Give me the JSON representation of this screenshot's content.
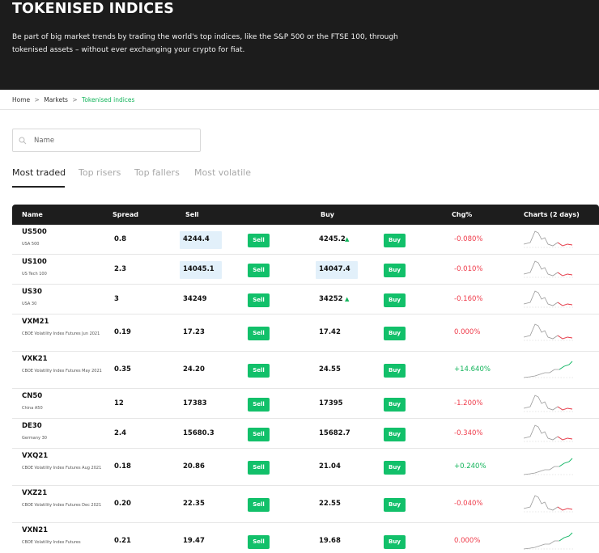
{
  "hero": {
    "title": "TOKENISED INDICES",
    "description": "Be part of big market trends by trading the world's top indices, like the S&P 500 or the FTSE 100, through tokenised assets – without ever exchanging your crypto for fiat."
  },
  "breadcrumb": {
    "home": "Home",
    "markets": "Markets",
    "current": "Tokenised indices",
    "separator": ">"
  },
  "search": {
    "placeholder": "Name",
    "value": ""
  },
  "tabs": [
    {
      "label": "Most traded",
      "active": true
    },
    {
      "label": "Top risers",
      "active": false
    },
    {
      "label": "Top fallers",
      "active": false
    },
    {
      "label": "Most volatile",
      "active": false
    }
  ],
  "table": {
    "headers": {
      "name": "Name",
      "spread": "Spread",
      "sell": "Sell",
      "buy": "Buy",
      "chg": "Chg%",
      "charts": "Charts (2 days)"
    },
    "sell_label": "Sell",
    "buy_label": "Buy",
    "rows": [
      {
        "symbol": "US500",
        "desc": "USA 500",
        "spread": "0.8",
        "sell": "4244.4",
        "buy": "4245.2",
        "buy_up": true,
        "sell_hl": true,
        "buy_hl": false,
        "chg": "-0.080%",
        "trend": "neg"
      },
      {
        "symbol": "US100",
        "desc": "US Tech 100",
        "spread": "2.3",
        "sell": "14045.1",
        "buy": "14047.4",
        "buy_up": false,
        "sell_hl": true,
        "buy_hl": true,
        "chg": "-0.010%",
        "trend": "neg"
      },
      {
        "symbol": "US30",
        "desc": "USA 30",
        "spread": "3",
        "sell": "34249",
        "buy": "34252",
        "buy_up": true,
        "sell_hl": false,
        "buy_hl": false,
        "chg": "-0.160%",
        "trend": "neg"
      },
      {
        "symbol": "VXM21",
        "desc": "CBOE Volatility Index Futures Jun 2021",
        "spread": "0.19",
        "sell": "17.23",
        "buy": "17.42",
        "buy_up": false,
        "sell_hl": false,
        "buy_hl": false,
        "chg": "0.000%",
        "trend": "neg"
      },
      {
        "symbol": "VXK21",
        "desc": "CBOE Volatility Index Futures May 2021",
        "spread": "0.35",
        "sell": "24.20",
        "buy": "24.55",
        "buy_up": false,
        "sell_hl": false,
        "buy_hl": false,
        "chg": "+14.640%",
        "trend": "pos"
      },
      {
        "symbol": "CN50",
        "desc": "China A50",
        "spread": "12",
        "sell": "17383",
        "buy": "17395",
        "buy_up": false,
        "sell_hl": false,
        "buy_hl": false,
        "chg": "-1.200%",
        "trend": "neg"
      },
      {
        "symbol": "DE30",
        "desc": "Germany 30",
        "spread": "2.4",
        "sell": "15680.3",
        "buy": "15682.7",
        "buy_up": false,
        "sell_hl": false,
        "buy_hl": false,
        "chg": "-0.340%",
        "trend": "neg"
      },
      {
        "symbol": "VXQ21",
        "desc": "CBOE Volatility Index Futures Aug 2021",
        "spread": "0.18",
        "sell": "20.86",
        "buy": "21.04",
        "buy_up": false,
        "sell_hl": false,
        "buy_hl": false,
        "chg": "+0.240%",
        "trend": "pos"
      },
      {
        "symbol": "VXZ21",
        "desc": "CBOE Volatility Index Futures Dec 2021",
        "spread": "0.20",
        "sell": "22.35",
        "buy": "22.55",
        "buy_up": false,
        "sell_hl": false,
        "buy_hl": false,
        "chg": "-0.040%",
        "trend": "neg"
      },
      {
        "symbol": "VXN21",
        "desc": "CBOE Volatility Index Futures",
        "spread": "0.21",
        "sell": "19.47",
        "buy": "19.68",
        "buy_up": false,
        "sell_hl": false,
        "buy_hl": false,
        "chg": "0.000%",
        "trend": "pos"
      }
    ]
  },
  "colors": {
    "accent_green": "#12c06a",
    "negative_red": "#ef3b4a",
    "header_dark": "#1c1c1c",
    "highlight_blue": "#e2f0fa"
  }
}
